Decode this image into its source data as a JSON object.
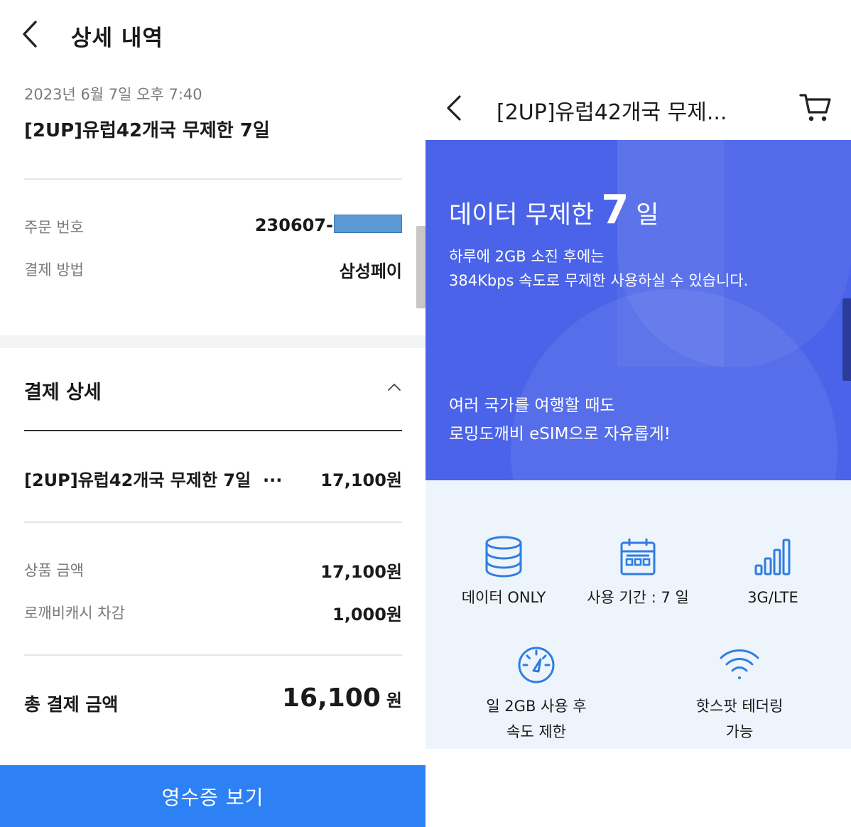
{
  "left": {
    "header": {
      "title": "상세 내역"
    },
    "order": {
      "datetime": "2023년 6월 7일 오후 7:40",
      "product_name": "[2UP]유럽42개국 무제한 7일",
      "order_number_label": "주문 번호",
      "order_number_value": "230607-",
      "payment_method_label": "결제 방법",
      "payment_method_value": "삼성페이"
    },
    "payment_detail": {
      "title": "결제 상세",
      "item_name": "[2UP]유럽42개국 무제한 7일",
      "item_ellipsis": "...",
      "item_price": "17,100원",
      "product_amount_label": "상품 금액",
      "product_amount_value": "17,100원",
      "cash_deduction_label": "로깨비캐시 차감",
      "cash_deduction_value": "1,000원",
      "total_label": "총 결제 금액",
      "total_value": "16,100",
      "total_unit": "원"
    },
    "receipt_button": "영수증 보기"
  },
  "right": {
    "header": {
      "title": "[2UP]유럽42개국 무제..."
    },
    "banner": {
      "headline_prefix": "데이터 무제한",
      "headline_number": "7",
      "headline_suffix": "일",
      "line1": "하루에 2GB 소진 후에는",
      "line2": "384Kbps 속도로 무제한 사용하실 수 있습니다.",
      "line3": "여러 국가를 여행할 때도",
      "line4": "로밍도깨비 eSIM으로 자유롭게!",
      "bg_color": "#4a63e8"
    },
    "features": [
      {
        "icon": "database-icon",
        "label": "데이터 ONLY"
      },
      {
        "icon": "calendar-icon",
        "label": "사용 기간 : 7 일"
      },
      {
        "icon": "signal-bars-icon",
        "label": "3G/LTE"
      },
      {
        "icon": "speedometer-icon",
        "label1": "일 2GB 사용 후",
        "label2": "속도 제한"
      },
      {
        "icon": "wifi-icon",
        "label1": "핫스팟 테더링",
        "label2": "가능"
      }
    ]
  },
  "colors": {
    "accent_blue": "#2e80f5",
    "icon_blue": "#2f7de1"
  }
}
